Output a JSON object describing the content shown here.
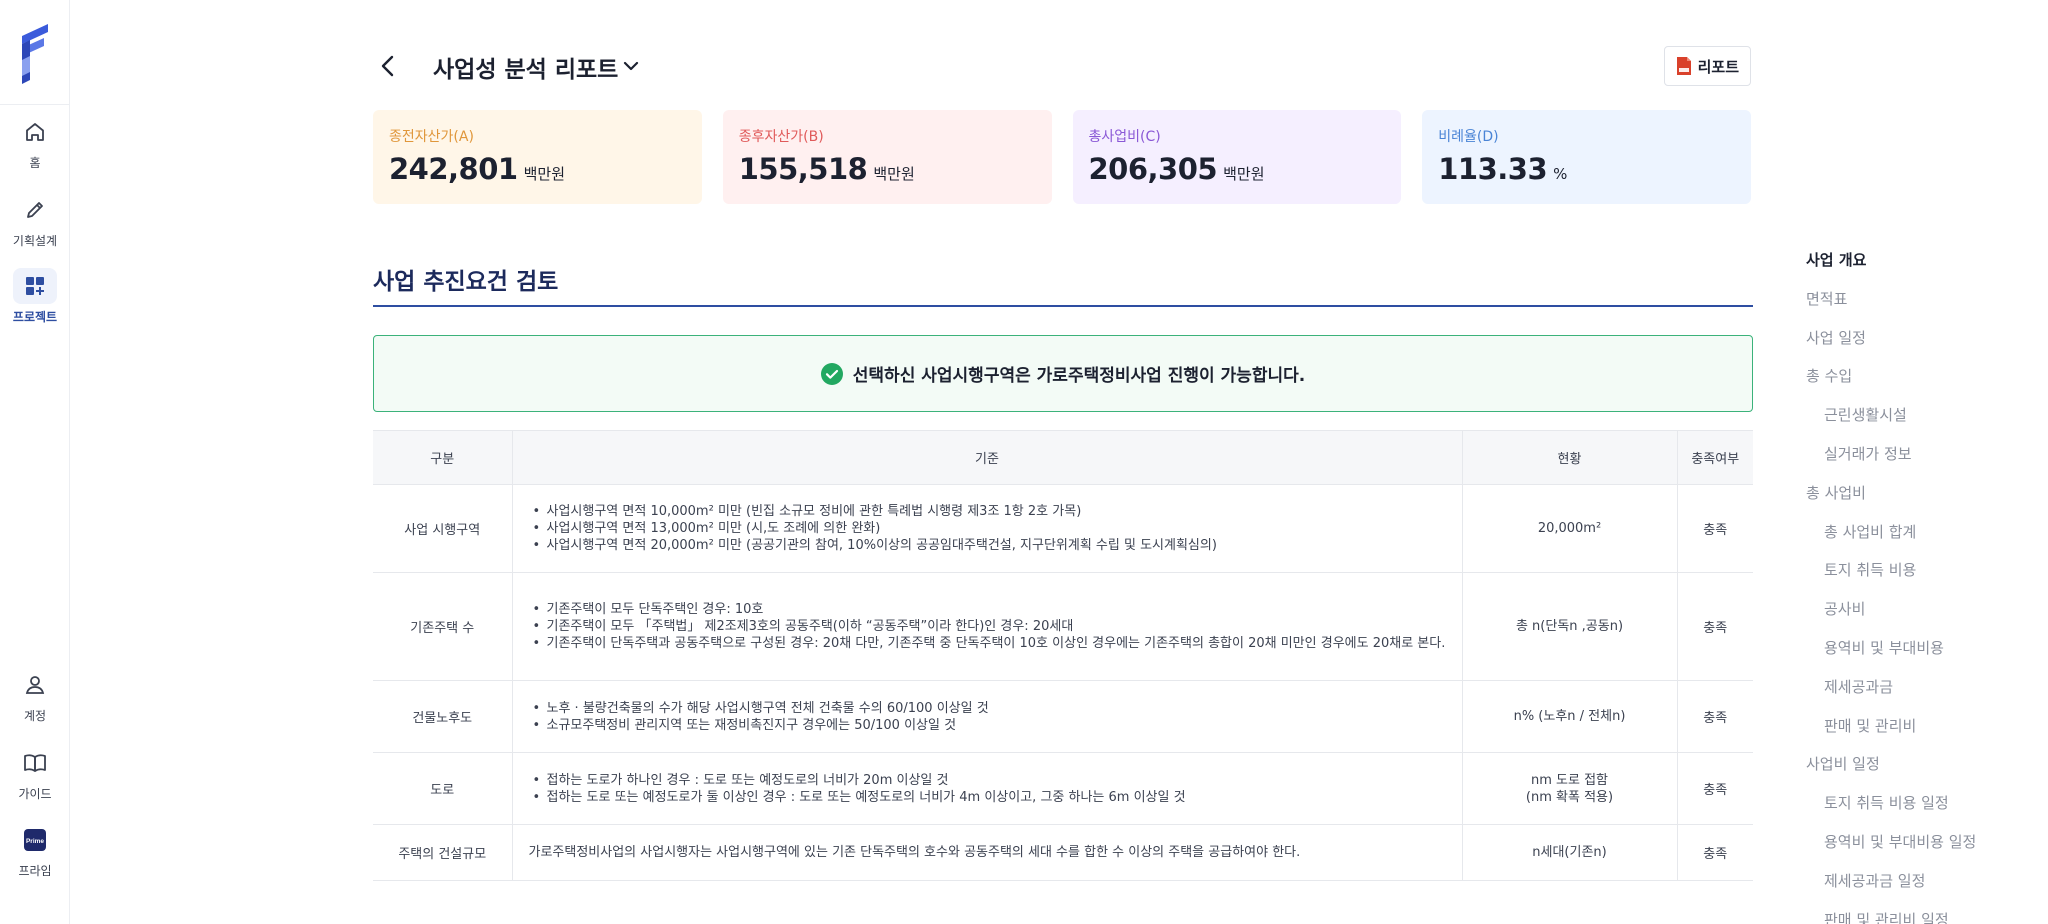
{
  "rail": {
    "items": [
      {
        "key": "home",
        "label": "홈",
        "icon": "home-icon"
      },
      {
        "key": "planning",
        "label": "기획설계",
        "icon": "pencil-icon"
      },
      {
        "key": "project",
        "label": "프로젝트",
        "icon": "grid-plus-icon",
        "active": true
      },
      {
        "key": "account",
        "label": "계정",
        "icon": "user-icon"
      },
      {
        "key": "guide",
        "label": "가이드",
        "icon": "book-icon"
      },
      {
        "key": "prime",
        "label": "프라임",
        "icon": "prime-badge-icon",
        "badge": "Prime"
      }
    ]
  },
  "header": {
    "title": "사업성 분석 리포트",
    "report_button": "리포트"
  },
  "metrics": [
    {
      "label": "종전자산가(A)",
      "value": "242,801",
      "unit": "백만원",
      "color": "#e0973b"
    },
    {
      "label": "종후자산가(B)",
      "value": "155,518",
      "unit": "백만원",
      "color": "#e05a5a"
    },
    {
      "label": "총사업비(C)",
      "value": "206,305",
      "unit": "백만원",
      "color": "#8a58d6"
    },
    {
      "label": "비례율(D)",
      "value": "113.33",
      "unit": "%",
      "color": "#4a84d6"
    }
  ],
  "section": {
    "title": "사업 추진요건 검토",
    "notice": "선택하신 사업시행구역은 가로주택정비사업 진행이 가능합니다."
  },
  "table": {
    "headers": [
      "구분",
      "기준",
      "현황",
      "충족여부"
    ],
    "rows": [
      {
        "category": "사업 시행구역",
        "criteria": [
          "사업시행구역 면적 10,000m² 미만 (빈집 소규모 정비에 관한 특례법 시행령 제3조 1항 2호 가목)",
          "사업시행구역 면적 13,000m² 미만 (시,도 조례에 의한 완화)",
          "사업시행구역 면적 20,000m² 미만 (공공기관의 참여, 10%이상의 공공임대주택건설, 지구단위계획 수립 및 도시계획심의)"
        ],
        "status": [
          "20,000m²"
        ],
        "result": "충족"
      },
      {
        "category": "기존주택 수",
        "criteria": [
          "기존주택이 모두 단독주택인 경우: 10호",
          "기존주택이 모두 「주택법」 제2조제3호의 공동주택(이하 “공동주택”이라 한다)인 경우: 20세대",
          "기존주택이 단독주택과 공동주택으로 구성된 경우: 20채 다만, 기존주택 중 단독주택이 10호 이상인 경우에는 기존주택의 총합이 20채 미만인 경우에도 20채로 본다."
        ],
        "status": [
          "총 n(단독n ,공동n)"
        ],
        "result": "충족"
      },
      {
        "category": "건물노후도",
        "criteria": [
          "노후 · 불량건축물의 수가 해당 사업시행구역 전체 건축물 수의 60/100 이상일 것",
          "소규모주택정비 관리지역 또는 재정비촉진지구 경우에는 50/100 이상일 것"
        ],
        "status": [
          "n% (노후n / 전체n)"
        ],
        "result": "충족"
      },
      {
        "category": "도로",
        "criteria": [
          "접하는 도로가 하나인 경우 : 도로 또는 예정도로의 너비가 20m 이상일 것",
          "접하는 도로 또는 예정도로가 둘 이상인 경우 : 도로 또는 예정도로의 너비가 4m 이상이고, 그중 하나는 6m 이상일 것"
        ],
        "status": [
          "nm 도로 접함",
          "(nm 확폭 적용)"
        ],
        "result": "충족"
      },
      {
        "category": "주택의 건설규모",
        "criteria_text": "가로주택정비사업의 사업시행자는 사업시행구역에 있는 기존 단독주택의 호수와 공동주택의 세대 수를 합한 수 이상의 주택을 공급하여야 한다.",
        "status": [
          "n세대(기존n)"
        ],
        "result": "충족"
      }
    ]
  },
  "toc": {
    "items": [
      {
        "label": "사업 개요",
        "active": true
      },
      {
        "label": "면적표"
      },
      {
        "label": "사업 일정"
      },
      {
        "label": "총 수입"
      },
      {
        "label": "근린생활시설",
        "sub": true
      },
      {
        "label": "실거래가 정보",
        "sub": true
      },
      {
        "label": "총 사업비"
      },
      {
        "label": "총 사업비 합계",
        "sub": true
      },
      {
        "label": "토지 취득 비용",
        "sub": true
      },
      {
        "label": "공사비",
        "sub": true
      },
      {
        "label": "용역비 및 부대비용",
        "sub": true
      },
      {
        "label": "제세공과금",
        "sub": true
      },
      {
        "label": "판매 및 관리비",
        "sub": true
      },
      {
        "label": "사업비 일정"
      },
      {
        "label": "토지 취득 비용 일정",
        "sub": true
      },
      {
        "label": "용역비 및 부대비용 일정",
        "sub": true
      },
      {
        "label": "제세공과금 일정",
        "sub": true
      },
      {
        "label": "판매 및 관리비 일정",
        "sub": true
      }
    ]
  },
  "colors": {
    "accent": "#2e4ea1",
    "success": "#3bb27a",
    "logo": "#3b5bdb"
  }
}
